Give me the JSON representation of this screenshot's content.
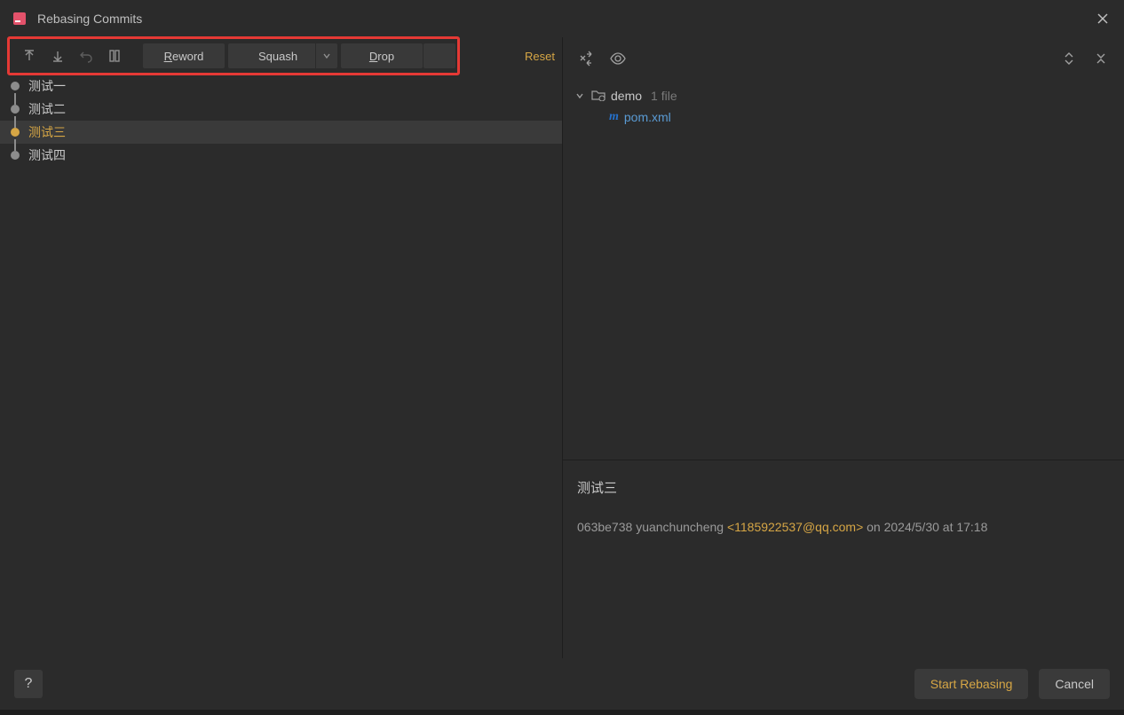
{
  "title": "Rebasing Commits",
  "toolbar": {
    "reword_prefix": "R",
    "reword_rest": "eword",
    "squash_prefix": "S",
    "squash_rest": "quash",
    "drop_prefix": "D",
    "drop_rest": "rop",
    "reset": "Reset"
  },
  "commits": [
    {
      "label": "测试一",
      "selected": false
    },
    {
      "label": "测试二",
      "selected": false
    },
    {
      "label": "测试三",
      "selected": true
    },
    {
      "label": "测试四",
      "selected": false
    }
  ],
  "tree": {
    "folder": "demo",
    "file_count": "1 file",
    "file_name": "pom.xml"
  },
  "details": {
    "title": "测试三",
    "hash": "063be738",
    "author": "yuanchuncheng",
    "email": "<1185922537@qq.com>",
    "on": " on ",
    "date": "2024/5/30 at 17:18"
  },
  "footer": {
    "help": "?",
    "start": "Start Rebasing",
    "cancel": "Cancel"
  }
}
